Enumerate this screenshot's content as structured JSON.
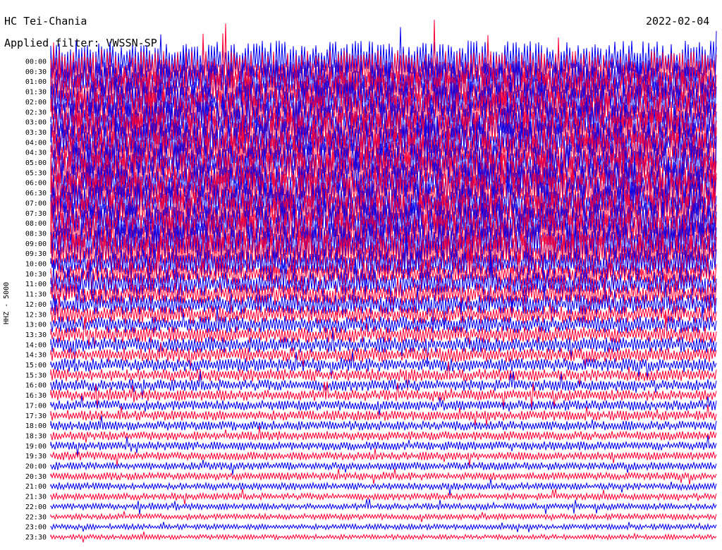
{
  "header": {
    "station": "HC Tei-Chania",
    "date": "2022-02-04",
    "filter": "Applied filter: VWSSN-SP",
    "channel_label": "HHZ - 5000"
  },
  "colors": {
    "odd": "#0000ee",
    "even": "#ff0033",
    "text": "#000000",
    "background": "#ffffff"
  },
  "chart_data": {
    "type": "line",
    "title": "HC Tei-Chania",
    "ylabel": "HHZ - 5000",
    "rows": [
      {
        "label": "00:00",
        "amp": 1.0
      },
      {
        "label": "00:30",
        "amp": 1.0
      },
      {
        "label": "01:00",
        "amp": 1.0
      },
      {
        "label": "01:30",
        "amp": 1.0
      },
      {
        "label": "02:00",
        "amp": 1.0
      },
      {
        "label": "02:30",
        "amp": 1.0
      },
      {
        "label": "03:00",
        "amp": 1.0
      },
      {
        "label": "03:30",
        "amp": 1.0
      },
      {
        "label": "04:00",
        "amp": 1.0
      },
      {
        "label": "04:30",
        "amp": 1.0
      },
      {
        "label": "05:00",
        "amp": 1.0
      },
      {
        "label": "05:30",
        "amp": 1.0
      },
      {
        "label": "06:00",
        "amp": 1.0
      },
      {
        "label": "06:30",
        "amp": 1.0
      },
      {
        "label": "07:00",
        "amp": 1.0
      },
      {
        "label": "07:30",
        "amp": 1.0
      },
      {
        "label": "08:00",
        "amp": 1.0
      },
      {
        "label": "08:30",
        "amp": 1.0
      },
      {
        "label": "09:00",
        "amp": 1.0
      },
      {
        "label": "09:30",
        "amp": 0.95
      },
      {
        "label": "10:00",
        "amp": 0.7
      },
      {
        "label": "10:30",
        "amp": 0.6
      },
      {
        "label": "11:00",
        "amp": 0.6
      },
      {
        "label": "11:30",
        "amp": 0.55
      },
      {
        "label": "12:00",
        "amp": 0.5
      },
      {
        "label": "12:30",
        "amp": 0.45
      },
      {
        "label": "13:00",
        "amp": 0.42
      },
      {
        "label": "13:30",
        "amp": 0.4
      },
      {
        "label": "14:00",
        "amp": 0.38
      },
      {
        "label": "14:30",
        "amp": 0.35
      },
      {
        "label": "15:00",
        "amp": 0.32
      },
      {
        "label": "15:30",
        "amp": 0.3
      },
      {
        "label": "16:00",
        "amp": 0.28
      },
      {
        "label": "16:30",
        "amp": 0.27
      },
      {
        "label": "17:00",
        "amp": 0.25
      },
      {
        "label": "17:30",
        "amp": 0.24
      },
      {
        "label": "18:00",
        "amp": 0.23
      },
      {
        "label": "18:30",
        "amp": 0.22
      },
      {
        "label": "19:00",
        "amp": 0.21
      },
      {
        "label": "19:30",
        "amp": 0.2
      },
      {
        "label": "20:00",
        "amp": 0.19
      },
      {
        "label": "20:30",
        "amp": 0.18
      },
      {
        "label": "21:00",
        "amp": 0.17
      },
      {
        "label": "21:30",
        "amp": 0.16
      },
      {
        "label": "22:00",
        "amp": 0.15
      },
      {
        "label": "22:30",
        "amp": 0.14
      },
      {
        "label": "23:00",
        "amp": 0.13
      },
      {
        "label": "23:30",
        "amp": 0.12
      }
    ],
    "grid": false
  }
}
